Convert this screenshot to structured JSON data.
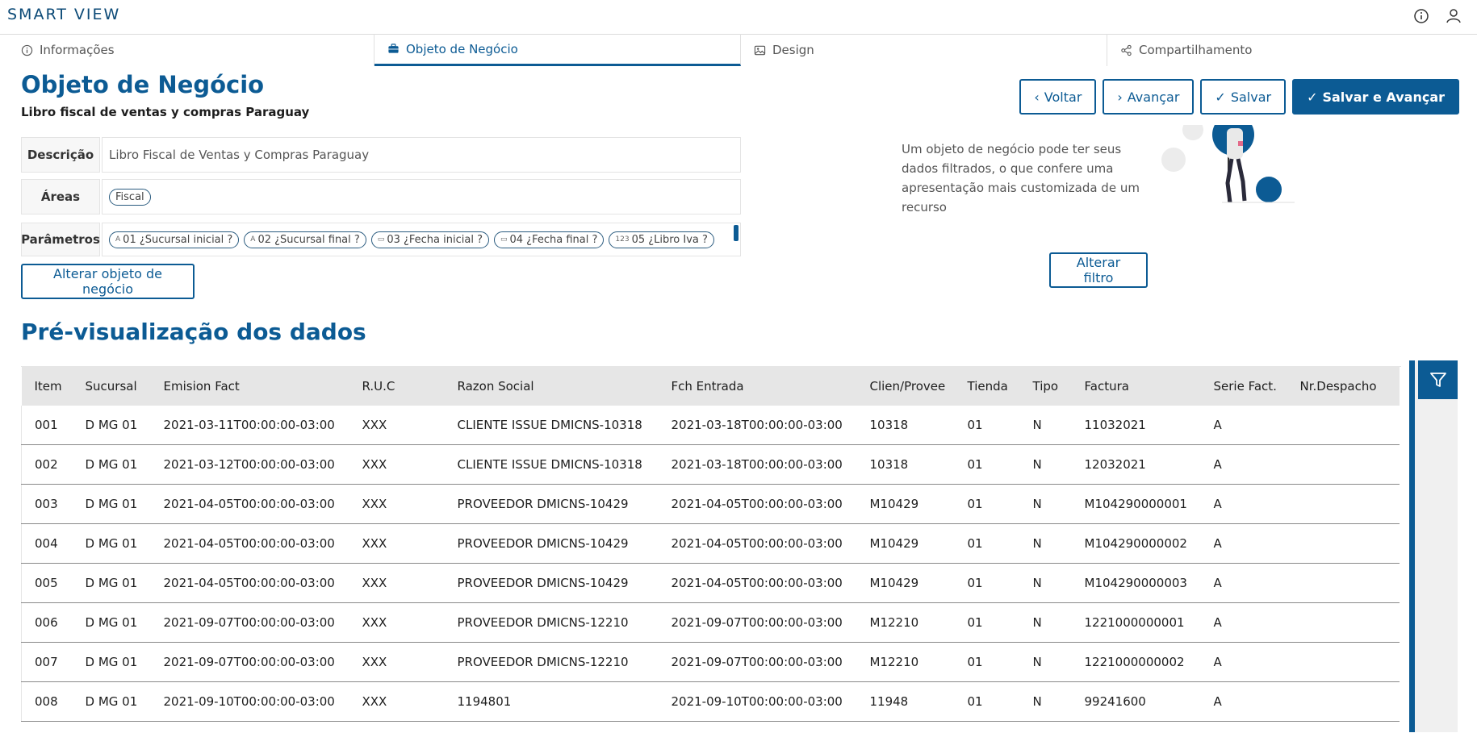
{
  "app": {
    "brand": "SMART VIEW"
  },
  "tabs": [
    {
      "label": "Informações",
      "icon": "info-icon"
    },
    {
      "label": "Objeto de Negócio",
      "icon": "briefcase-icon"
    },
    {
      "label": "Design",
      "icon": "image-icon"
    },
    {
      "label": "Compartilhamento",
      "icon": "share-icon"
    }
  ],
  "active_tab": "Objeto de Negócio",
  "header": {
    "title": "Objeto de Negócio",
    "subtitle": "Libro fiscal de ventas y compras Paraguay"
  },
  "actions": {
    "back": "Voltar",
    "next": "Avançar",
    "save": "Salvar",
    "save_next": "Salvar e Avançar"
  },
  "fields": {
    "description_label": "Descrição",
    "description_value": "Libro Fiscal de Ventas y Compras Paraguay",
    "areas_label": "Áreas",
    "area_chip": "Fiscal",
    "params_label": "Parâmetros",
    "params": [
      {
        "type": "A",
        "label": "01 ¿Sucursal inicial ?"
      },
      {
        "type": "A",
        "label": "02 ¿Sucursal final ?"
      },
      {
        "type": "date",
        "label": "03 ¿Fecha inicial ?"
      },
      {
        "type": "date",
        "label": "04 ¿Fecha final ?"
      },
      {
        "type": "123",
        "label": "05 ¿Libro Iva ?"
      }
    ]
  },
  "buttons": {
    "change_object": "Alterar objeto de negócio",
    "change_filter": "Alterar filtro"
  },
  "info": {
    "text": "Um objeto de negócio pode ter seus dados filtrados, o que confere uma apresentação mais customizada de um recurso"
  },
  "preview": {
    "title": "Pré-visualização dos dados",
    "columns": [
      "Item",
      "Sucursal",
      "Emision Fact",
      "R.U.C",
      "Razon Social",
      "Fch Entrada",
      "Clien/Provee",
      "Tienda",
      "Tipo",
      "Factura",
      "Serie Fact.",
      "Nr.Despacho"
    ],
    "rows": [
      [
        "001",
        "D MG 01",
        "2021-03-11T00:00:00-03:00",
        "XXX",
        "CLIENTE ISSUE DMICNS-10318",
        "2021-03-18T00:00:00-03:00",
        "10318",
        "01",
        "N",
        "11032021",
        "A",
        ""
      ],
      [
        "002",
        "D MG 01",
        "2021-03-12T00:00:00-03:00",
        "XXX",
        "CLIENTE ISSUE DMICNS-10318",
        "2021-03-18T00:00:00-03:00",
        "10318",
        "01",
        "N",
        "12032021",
        "A",
        ""
      ],
      [
        "003",
        "D MG 01",
        "2021-04-05T00:00:00-03:00",
        "XXX",
        "PROVEEDOR DMICNS-10429",
        "2021-04-05T00:00:00-03:00",
        "M10429",
        "01",
        "N",
        "M104290000001",
        "A",
        ""
      ],
      [
        "004",
        "D MG 01",
        "2021-04-05T00:00:00-03:00",
        "XXX",
        "PROVEEDOR DMICNS-10429",
        "2021-04-05T00:00:00-03:00",
        "M10429",
        "01",
        "N",
        "M104290000002",
        "A",
        ""
      ],
      [
        "005",
        "D MG 01",
        "2021-04-05T00:00:00-03:00",
        "XXX",
        "PROVEEDOR DMICNS-10429",
        "2021-04-05T00:00:00-03:00",
        "M10429",
        "01",
        "N",
        "M104290000003",
        "A",
        ""
      ],
      [
        "006",
        "D MG 01",
        "2021-09-07T00:00:00-03:00",
        "XXX",
        "PROVEEDOR DMICNS-12210",
        "2021-09-07T00:00:00-03:00",
        "M12210",
        "01",
        "N",
        "1221000000001",
        "A",
        ""
      ],
      [
        "007",
        "D MG 01",
        "2021-09-07T00:00:00-03:00",
        "XXX",
        "PROVEEDOR DMICNS-12210",
        "2021-09-07T00:00:00-03:00",
        "M12210",
        "01",
        "N",
        "1221000000002",
        "A",
        ""
      ],
      [
        "008",
        "D MG 01",
        "2021-09-10T00:00:00-03:00",
        "XXX",
        "1194801",
        "2021-09-10T00:00:00-03:00",
        "11948",
        "01",
        "N",
        "99241600",
        "A",
        ""
      ]
    ]
  },
  "colors": {
    "primary": "#0c5b94",
    "header_bg": "#e6e6e6"
  }
}
